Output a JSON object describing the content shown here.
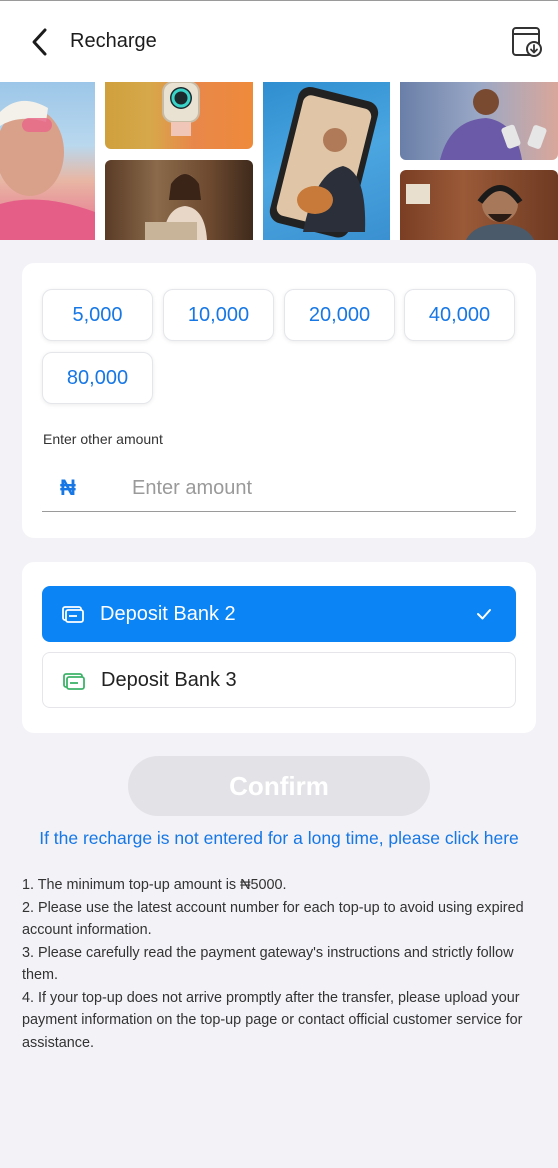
{
  "header": {
    "title": "Recharge",
    "back_icon": "chevron-left-icon",
    "record_icon": "download-record-icon"
  },
  "banner": {
    "photos": [
      "woman-sunglasses-photo",
      "smartwatch-photo",
      "woman-laptop-photo",
      "phone-guitar-photo",
      "people-phones-photo",
      "man-headphones-photo"
    ]
  },
  "amounts": {
    "options": [
      "5,000",
      "10,000",
      "20,000",
      "40,000",
      "80,000"
    ],
    "other_label": "Enter other amount",
    "currency_symbol": "₦",
    "input_placeholder": "Enter amount",
    "input_value": ""
  },
  "banks": {
    "items": [
      {
        "label": "Deposit Bank 2",
        "selected": true
      },
      {
        "label": "Deposit Bank 3",
        "selected": false
      }
    ]
  },
  "actions": {
    "confirm_label": "Confirm",
    "help_link": "If the recharge is not entered for a long time, please click here"
  },
  "notes": [
    "1. The minimum top-up amount is ₦5000.",
    "2. Please use the latest account number for each top-up to avoid using expired account information.",
    "3. Please carefully read the payment gateway's instructions and strictly follow them.",
    "4. If your top-up does not arrive promptly after the transfer, please upload your payment information on the top-up page or contact official customer service for assistance."
  ],
  "colors": {
    "accent": "#1677e5",
    "selected_bank_bg": "#0b84f5",
    "confirm_disabled_bg": "#e3e3e7",
    "page_bg": "#f2f2f7"
  }
}
